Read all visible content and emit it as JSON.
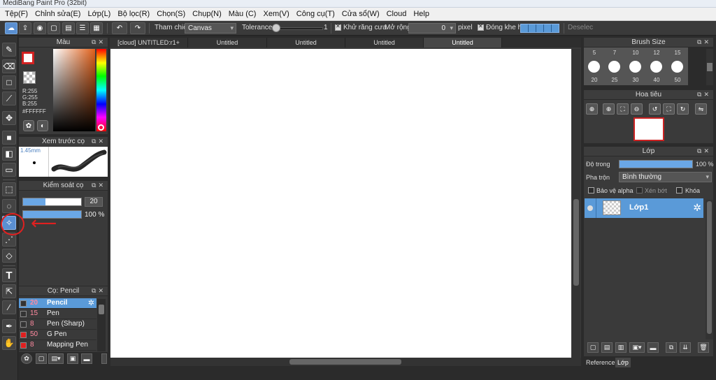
{
  "window": {
    "title": "MediBang Paint Pro (32bit)"
  },
  "menu": [
    "Tệp(F)",
    "Chỉnh sửa(E)",
    "Lớp(L)",
    "Bộ lọc(R)",
    "Chọn(S)",
    "Chụp(N)",
    "Màu (C)",
    "Xem(V)",
    "Công cụ(T)",
    "Cửa sổ(W)",
    "Cloud",
    "Help"
  ],
  "toolbar": {
    "reference_label": "Tham chiếu",
    "reference_value": "Canvas",
    "tolerance_label": "Tolerance",
    "tolerance_value": "1",
    "tolerance_fraction": 0.02,
    "antialias_label": "Khử răng cưa",
    "expand_label": "Mở rộng",
    "expand_value": "0",
    "pixel_label": "pixel",
    "close_gap_label": "Đóng khe hở",
    "deselect_label": "Deselec"
  },
  "panels": {
    "color": {
      "title": "Màu",
      "r": "R:255",
      "g": "G:255",
      "b": "B:255",
      "hex": "#FFFFFF",
      "primary_color": "#ffffff",
      "accent_color": "#d22222"
    },
    "brush_preview": {
      "title": "Xem trước cọ",
      "size": "1.45mm"
    },
    "brush_control": {
      "title": "Kiểm soát cọ",
      "size_value": "20",
      "size_fraction": 0.38,
      "opacity_value": "100 %",
      "opacity_fraction": 1.0
    },
    "brush_list": {
      "title": "Cọ: Pencil",
      "items": [
        {
          "num": "20",
          "name": "Pencil",
          "color": "#333333",
          "active": true
        },
        {
          "num": "15",
          "name": "Pen",
          "color": "#333333",
          "active": false
        },
        {
          "num": "8",
          "name": "Pen (Sharp)",
          "color": "#333333",
          "active": false
        },
        {
          "num": "50",
          "name": "G Pen",
          "color": "#e02020",
          "active": false
        },
        {
          "num": "8",
          "name": "Mapping Pen",
          "color": "#e02020",
          "active": false
        }
      ]
    },
    "brush_size": {
      "title": "Brush Size",
      "top_sizes": [
        "5",
        "7",
        "10",
        "12",
        "15"
      ],
      "bottom_sizes": [
        "20",
        "25",
        "30",
        "40",
        "50"
      ]
    },
    "navigator": {
      "title": "Hoa tiêu"
    },
    "layer": {
      "title": "Lớp",
      "opacity_label": "Độ trong",
      "opacity_value": "100 %",
      "opacity_fraction": 1.0,
      "blend_label": "Pha trộn",
      "blend_value": "Bình thường",
      "protect_alpha": "Bảo vệ alpha",
      "clipping": "Xén bớt",
      "lock": "Khóa",
      "layers": [
        {
          "name": "Lớp1"
        }
      ]
    }
  },
  "tabs": [
    "[cloud] UNTITLED:r1+",
    "Untitled",
    "Untitled",
    "Untitled",
    "Untitled"
  ],
  "bottom_tabs": [
    "Reference",
    "Lớp"
  ]
}
